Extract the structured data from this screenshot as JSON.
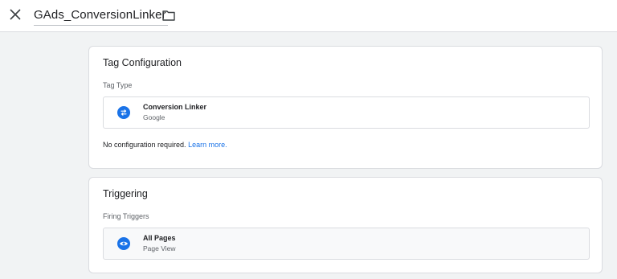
{
  "header": {
    "title": "GAds_ConversionLinker",
    "close_icon": "close-icon",
    "folder_icon": "folder-icon"
  },
  "tag_configuration": {
    "title": "Tag Configuration",
    "section_label": "Tag Type",
    "tag_type": {
      "name": "Conversion Linker",
      "vendor": "Google",
      "icon": "conversion-linker-icon"
    },
    "note": "No configuration required.",
    "learn_more": "Learn more."
  },
  "triggering": {
    "title": "Triggering",
    "section_label": "Firing Triggers",
    "trigger": {
      "name": "All Pages",
      "type": "Page View",
      "icon": "eye-icon"
    }
  },
  "colors": {
    "accent": "#1a73e8",
    "background": "#f1f3f4",
    "card": "#ffffff",
    "border": "#dadce0"
  }
}
